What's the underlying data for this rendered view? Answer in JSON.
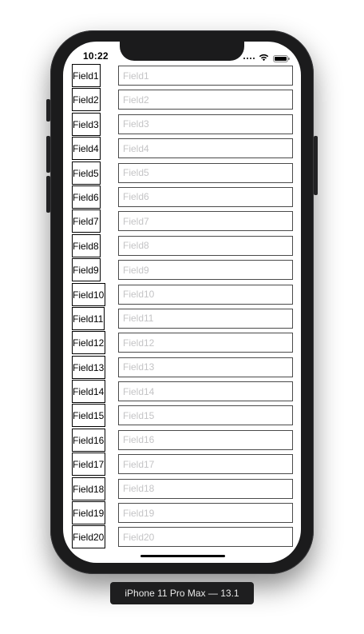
{
  "status_bar": {
    "time": "10:22",
    "icons": [
      "signal-icon",
      "wifi-icon",
      "battery-icon"
    ]
  },
  "form": {
    "rows": [
      {
        "label": "Field1",
        "value": "",
        "placeholder": "Field1"
      },
      {
        "label": "Field2",
        "value": "",
        "placeholder": "Field2"
      },
      {
        "label": "Field3",
        "value": "",
        "placeholder": "Field3"
      },
      {
        "label": "Field4",
        "value": "",
        "placeholder": "Field4"
      },
      {
        "label": "Field5",
        "value": "",
        "placeholder": "Field5"
      },
      {
        "label": "Field6",
        "value": "",
        "placeholder": "Field6"
      },
      {
        "label": "Field7",
        "value": "",
        "placeholder": "Field7"
      },
      {
        "label": "Field8",
        "value": "",
        "placeholder": "Field8"
      },
      {
        "label": "Field9",
        "value": "",
        "placeholder": "Field9"
      },
      {
        "label": "Field10",
        "value": "",
        "placeholder": "Field10"
      },
      {
        "label": "Field11",
        "value": "",
        "placeholder": "Field11"
      },
      {
        "label": "Field12",
        "value": "",
        "placeholder": "Field12"
      },
      {
        "label": "Field13",
        "value": "",
        "placeholder": "Field13"
      },
      {
        "label": "Field14",
        "value": "",
        "placeholder": "Field14"
      },
      {
        "label": "Field15",
        "value": "",
        "placeholder": "Field15"
      },
      {
        "label": "Field16",
        "value": "",
        "placeholder": "Field16"
      },
      {
        "label": "Field17",
        "value": "",
        "placeholder": "Field17"
      },
      {
        "label": "Field18",
        "value": "",
        "placeholder": "Field18"
      },
      {
        "label": "Field19",
        "value": "",
        "placeholder": "Field19"
      },
      {
        "label": "Field20",
        "value": "",
        "placeholder": "Field20"
      }
    ]
  },
  "device": {
    "caption": "iPhone 11 Pro Max — 13.1"
  },
  "colors": {
    "device_frame": "#1b1b1c",
    "screen_background": "#ffffff",
    "placeholder_text": "#c4c4c6",
    "caption_background": "#1e1e1f"
  }
}
